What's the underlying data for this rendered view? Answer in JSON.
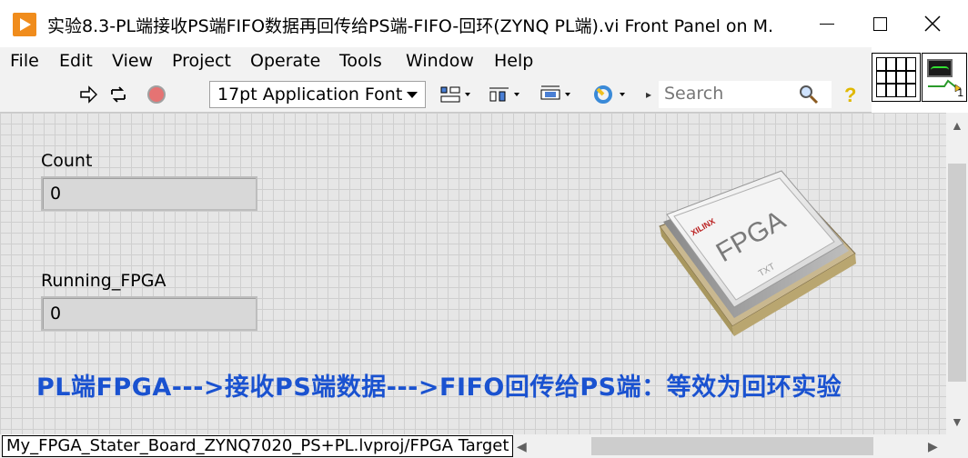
{
  "window": {
    "title": "实验8.3-PL端接收PS端FIFO数据再回传给PS端-FIFO-回环(ZYNQ PL端).vi Front Panel on M..."
  },
  "menu": {
    "items": [
      "File",
      "Edit",
      "View",
      "Project",
      "Operate",
      "Tools",
      "Window",
      "Help"
    ]
  },
  "toolbar": {
    "font_select": "17pt Application Font",
    "search_placeholder": "Search",
    "help_glyph": "?"
  },
  "icons": {
    "run": "run-arrow-icon",
    "run_continuous": "run-continuously-icon",
    "abort": "abort-icon",
    "align": "align-objects-icon",
    "distribute": "distribute-objects-icon",
    "resize": "resize-objects-icon",
    "reorder": "reorder-icon",
    "search": "search-icon",
    "help": "help-icon"
  },
  "vi_icon_number": "1",
  "panel": {
    "count_label": "Count",
    "count_value": "0",
    "running_label": "Running_FPGA",
    "running_value": "0",
    "banner": "PL端FPGA--->接收PS端数据--->FIFO回传给PS端：等效为回环实验",
    "chip_text": "FPGA",
    "chip_brand": "XILINX",
    "chip_sub": "TXT"
  },
  "status": {
    "path": "My_FPGA_Stater_Board_ZYNQ7020_PS+PL.lvproj/FPGA Target"
  },
  "colors": {
    "banner": "#1a52d0",
    "canvas": "#e6e6e6",
    "title_icon": "#f08c1c"
  }
}
